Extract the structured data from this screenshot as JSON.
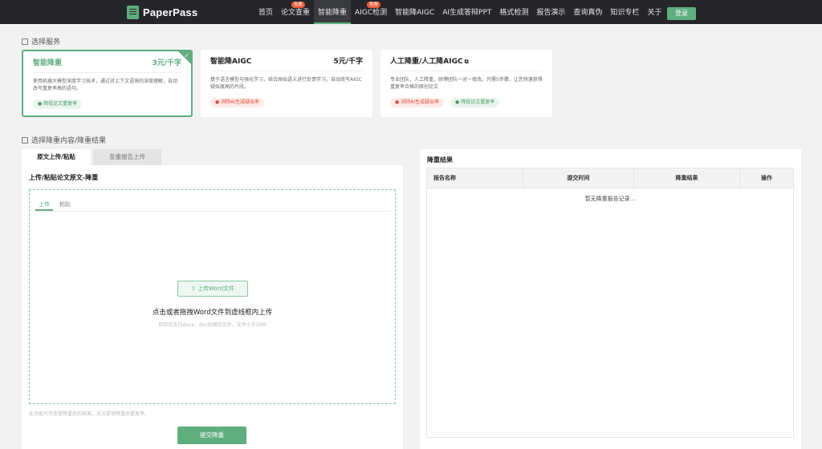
{
  "header": {
    "logo": "PaperPass",
    "nav": [
      {
        "label": "首页",
        "badge": ""
      },
      {
        "label": "论文查重",
        "badge": "免费"
      },
      {
        "label": "智能降重",
        "badge": "",
        "active": true
      },
      {
        "label": "AIGC检测",
        "badge": "免费"
      },
      {
        "label": "智能降AIGC",
        "badge": ""
      },
      {
        "label": "AI生成答辩PPT",
        "badge": ""
      },
      {
        "label": "格式检测",
        "badge": ""
      },
      {
        "label": "报告演示",
        "badge": ""
      },
      {
        "label": "查询真伪",
        "badge": ""
      },
      {
        "label": "知识专栏",
        "badge": ""
      },
      {
        "label": "关于",
        "badge": ""
      }
    ],
    "login": "登录"
  },
  "services": {
    "title": "选择服务",
    "cards": [
      {
        "name": "智能降重",
        "price": "3元/千字",
        "desc": "使用机器大模型深度学习技术，通过对上下文语境的深度理解，自动改写重复率高的语句。",
        "tags": [
          {
            "text": "降低论文重复率",
            "color": "green"
          }
        ],
        "selected": true
      },
      {
        "name": "智能降AIGC",
        "price": "5元/千字",
        "desc": "基于语言模型与强化学习，结合原始语义进行反馈学习，自动改写AIGC疑似度高的片段。",
        "tags": [
          {
            "text": "消除AI生成疑似率",
            "color": "red"
          }
        ],
        "selected": false
      },
      {
        "name": "人工降重/人工降AIGC",
        "price": "",
        "desc": "专业团队，人工降重，硕博团队一对一修改。只需5步骤，让您快速获得重复率合格的原创论文",
        "tags": [
          {
            "text": "消除AI生成疑似率",
            "color": "red"
          },
          {
            "text": "降低论文重复率",
            "color": "green"
          }
        ],
        "selected": false
      }
    ]
  },
  "content": {
    "title": "选择降重内容/降重结果",
    "tabs": [
      "原文上传/粘贴",
      "查重报告上传"
    ],
    "heading": "上传/粘贴论文原文-降重",
    "subtabs": [
      "上传",
      "粘贴"
    ],
    "upload_button": "上传Word文件",
    "upload_hint": "点击或者拖拽Word文件到虚线框内上传",
    "upload_sub": "目前仅支持docx、doc后缀的文件，文件小于30M",
    "note": "此功能只可查看降重后的结果，无法提供降重后重复率。",
    "submit": "提交降重"
  },
  "results": {
    "title": "降重结果",
    "columns": [
      "报告名称",
      "提交时间",
      "降重结果",
      "操作"
    ],
    "empty": "暂无降重报告记录..."
  },
  "colors": {
    "accent": "#5fae7e",
    "header_bg": "#26262a",
    "badge": "#e85c3a"
  }
}
